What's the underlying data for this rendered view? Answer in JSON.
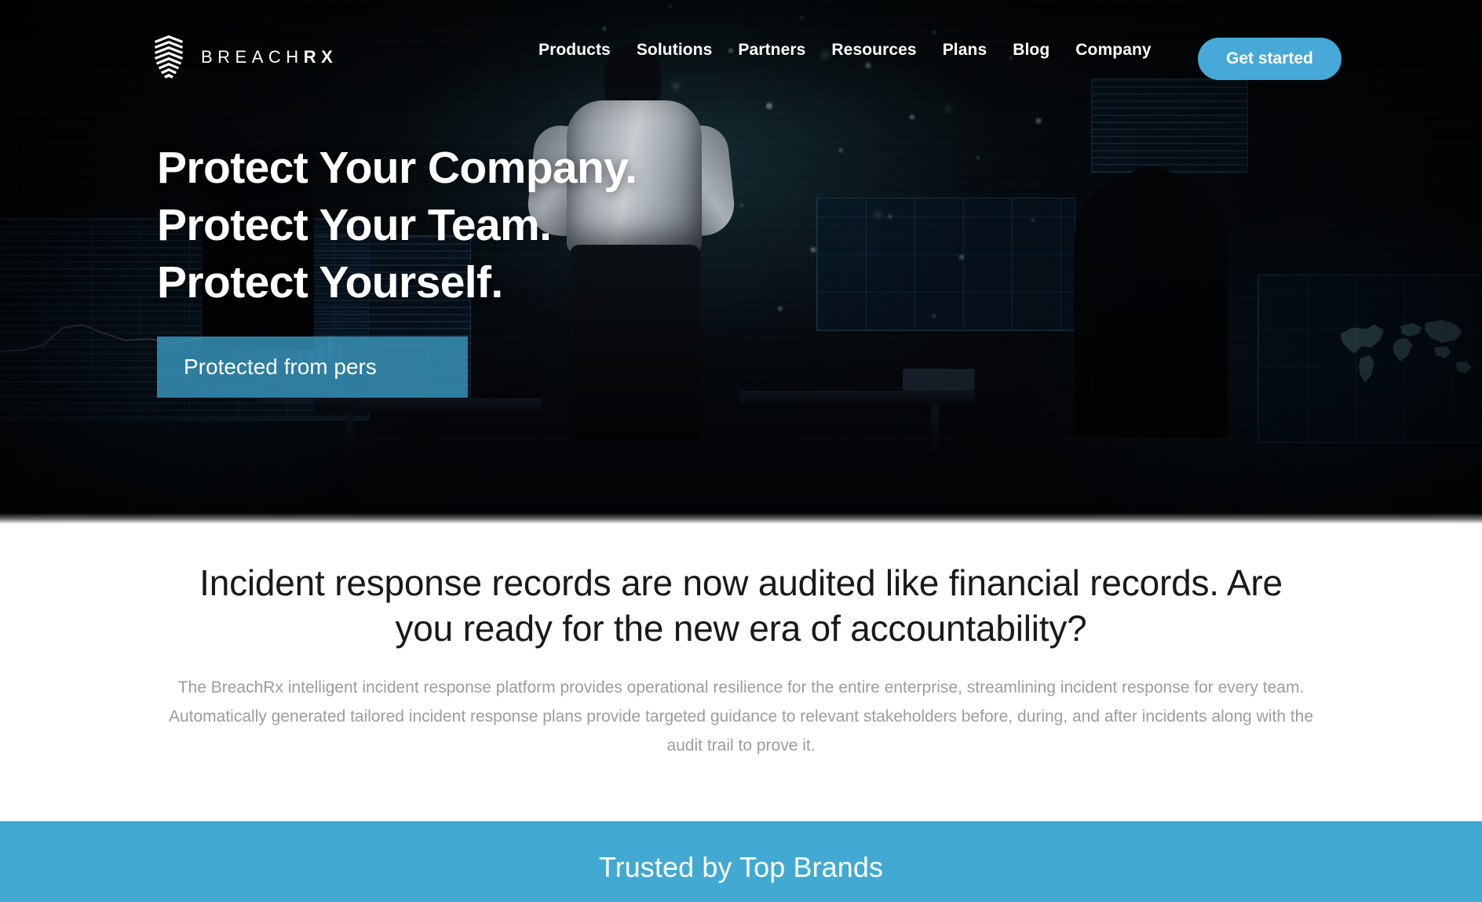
{
  "brand": {
    "logo_icon": "shield-stripes-icon",
    "name_light": "BREACH",
    "name_bold": "RX",
    "accent_color": "#42aad2",
    "button_color": "#46a9d8"
  },
  "nav": {
    "links": [
      {
        "label": "Products"
      },
      {
        "label": "Solutions"
      },
      {
        "label": "Partners"
      },
      {
        "label": "Resources"
      },
      {
        "label": "Plans"
      },
      {
        "label": "Blog"
      },
      {
        "label": "Company"
      }
    ],
    "cta_label": "Get started"
  },
  "hero": {
    "heading_line1": "Protect Your Company.",
    "heading_line2": "Protect Your Team.",
    "heading_line3": "Protect Yourself.",
    "cta_label": "Protected from pers",
    "background_description": "security operations center with analyst facing data wall"
  },
  "intro": {
    "heading": "Incident response records are now audited like financial records. Are you ready for the new era of accountability?",
    "paragraph": "The BreachRx intelligent incident response platform provides operational resilience for the entire enterprise, streamlining incident response for every team. Automatically generated tailored incident response plans provide targeted guidance to relevant stakeholders before, during, and after incidents along with the audit trail to prove it."
  },
  "brands": {
    "title": "Trusted by Top Brands",
    "band_color": "#42aad2"
  }
}
